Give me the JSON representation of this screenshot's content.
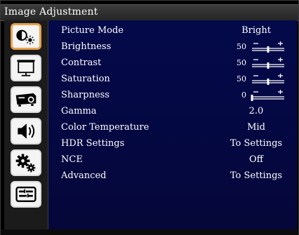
{
  "window": {
    "title": "Image Adjustment"
  },
  "sidebar": {
    "items": [
      {
        "icon": "picture-adjust-icon",
        "active": true
      },
      {
        "icon": "screen-icon",
        "active": false
      },
      {
        "icon": "projector-icon",
        "active": false
      },
      {
        "icon": "speaker-icon",
        "active": false
      },
      {
        "icon": "gears-icon",
        "active": false
      },
      {
        "icon": "settings-panel-icon",
        "active": false
      }
    ]
  },
  "settings": [
    {
      "label": "Picture Mode",
      "value": "Bright"
    },
    {
      "label": "Brightness",
      "value": "50",
      "level": 0.5
    },
    {
      "label": "Contrast",
      "value": "50",
      "level": 0.5
    },
    {
      "label": "Saturation",
      "value": "50",
      "level": 0.5
    },
    {
      "label": "Sharpness",
      "value": "0",
      "level": 0.0
    },
    {
      "label": "Gamma",
      "value": "2.0"
    },
    {
      "label": "Color Temperature",
      "value": "Mid"
    },
    {
      "label": "HDR Settings",
      "value": "To Settings"
    },
    {
      "label": "NCE",
      "value": "Off"
    },
    {
      "label": "Advanced",
      "value": "To Settings"
    }
  ],
  "colors": {
    "background": "#04094a",
    "active_border": "#e8a24a",
    "sidebar": "#1b1b1b"
  }
}
